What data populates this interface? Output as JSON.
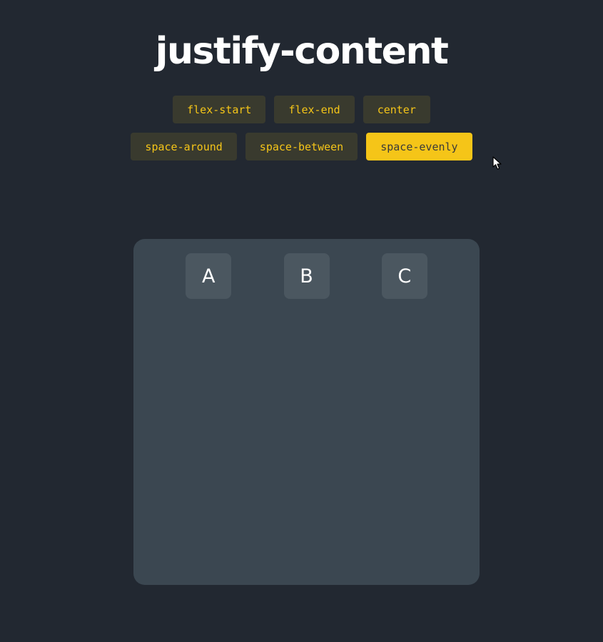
{
  "title": "justify-content",
  "buttons_row1": [
    {
      "label": "flex-start",
      "active": false
    },
    {
      "label": "flex-end",
      "active": false
    },
    {
      "label": "center",
      "active": false
    }
  ],
  "buttons_row2": [
    {
      "label": "space-around",
      "active": false
    },
    {
      "label": "space-between",
      "active": false
    },
    {
      "label": "space-evenly",
      "active": true
    }
  ],
  "items": [
    "A",
    "B",
    "C"
  ],
  "colors": {
    "background": "#222831",
    "accent": "#f5c518",
    "button_bg": "#393a2e",
    "container": "#3b4751",
    "item": "#4b5760"
  },
  "icons": {
    "cursor": "mouse-pointer-icon"
  }
}
